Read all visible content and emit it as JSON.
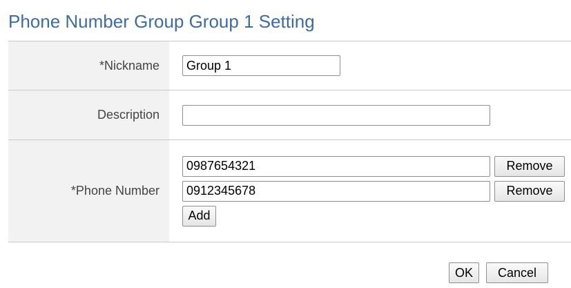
{
  "page": {
    "title": "Phone Number Group Group 1 Setting"
  },
  "form": {
    "nickname": {
      "label": "*Nickname",
      "value": "Group 1"
    },
    "description": {
      "label": "Description",
      "value": ""
    },
    "phone": {
      "label": "*Phone Number",
      "numbers": [
        {
          "value": "0987654321",
          "remove_label": "Remove"
        },
        {
          "value": "0912345678",
          "remove_label": "Remove"
        }
      ],
      "add_label": "Add"
    }
  },
  "footer": {
    "ok_label": "OK",
    "cancel_label": "Cancel"
  },
  "colors": {
    "title": "#3d6ba3",
    "label_background": "#f2f2f2",
    "row_border": "#c9c9c9"
  }
}
